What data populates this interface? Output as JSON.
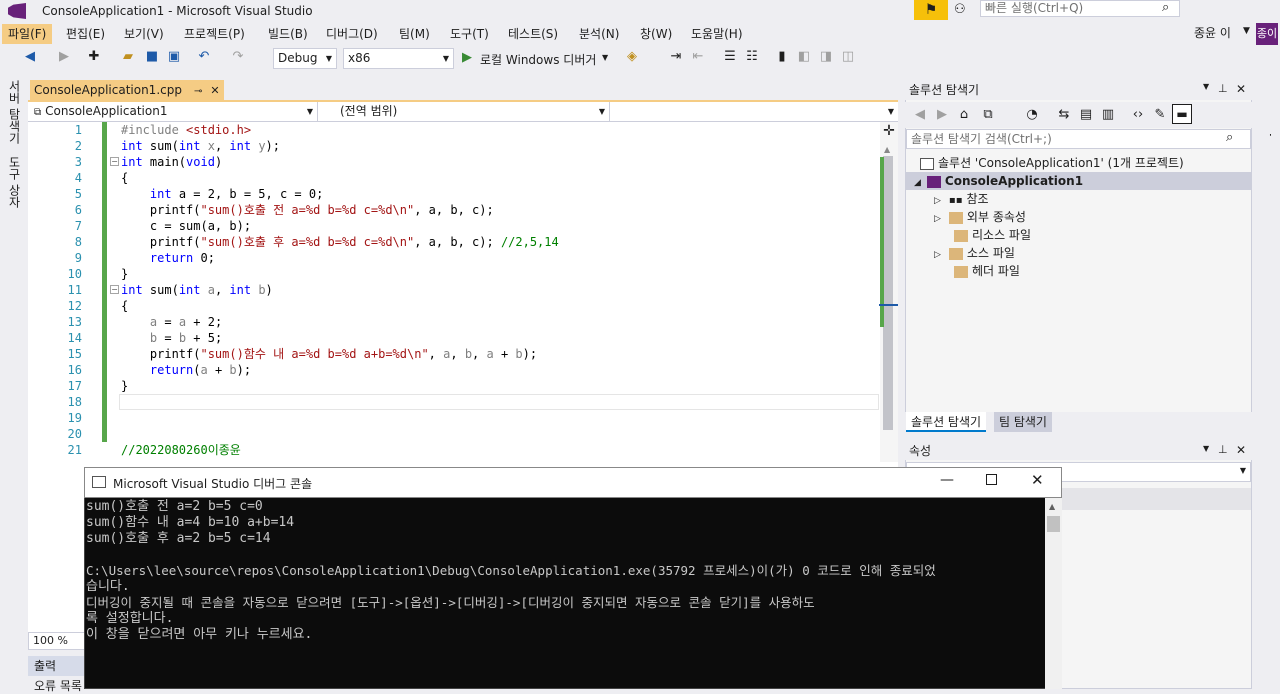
{
  "window": {
    "title": "ConsoleApplication1 - Microsoft Visual Studio",
    "quick_launch_placeholder": "빠른 실행(Ctrl+Q)",
    "user": "종윤 이",
    "user_badge": "종이"
  },
  "menu": [
    "파일(F)",
    "편집(E)",
    "보기(V)",
    "프로젝트(P)",
    "빌드(B)",
    "디버그(D)",
    "팀(M)",
    "도구(T)",
    "테스트(S)",
    "분석(N)",
    "창(W)",
    "도움말(H)"
  ],
  "toolbar": {
    "config": "Debug",
    "platform": "x86",
    "run_label": "로컬 Windows 디버거"
  },
  "left_strip": {
    "server_explorer": "서버 탐색기",
    "toolbox": "도구 상자"
  },
  "editor": {
    "tab_label": "ConsoleApplication1.cpp",
    "nav_project": "ConsoleApplication1",
    "nav_scope": "(전역 범위)",
    "zoom": "100 %",
    "line_numbers": [
      "1",
      "2",
      "3",
      "4",
      "5",
      "6",
      "7",
      "8",
      "9",
      "10",
      "11",
      "12",
      "13",
      "14",
      "15",
      "16",
      "17",
      "18",
      "19",
      "20",
      "21"
    ]
  },
  "code": {
    "l1a": "#include ",
    "l1b": "<stdio.h>",
    "l2a": "int",
    "l2b": " sum(",
    "l2c": "int",
    "l2d": " x",
    "l2e": ", ",
    "l2f": "int",
    "l2g": " y",
    "l2h": ");",
    "l3a": "int",
    "l3b": " main(",
    "l3c": "void",
    "l3d": ")",
    "l4": "{",
    "l5a": "    ",
    "l5b": "int",
    "l5c": " a = 2, b = 5, c = 0;",
    "l6a": "    printf(",
    "l6b": "\"sum()호출 전 a=%d b=%d c=%d\\n\"",
    "l6c": ", a, b, c);",
    "l7": "    c = sum(a, b);",
    "l8a": "    printf(",
    "l8b": "\"sum()호출 후 a=%d b=%d c=%d\\n\"",
    "l8c": ", a, b, c); ",
    "l8d": "//2,5,14",
    "l9a": "    ",
    "l9b": "return",
    "l9c": " 0;",
    "l10": "}",
    "l11a": "int",
    "l11b": " sum(",
    "l11c": "int",
    "l11d": " a",
    "l11e": ", ",
    "l11f": "int",
    "l11g": " b",
    "l11h": ")",
    "l12": "{",
    "l13a": "    ",
    "l13b": "a",
    "l13c": " = ",
    "l13d": "a",
    "l13e": " + 2;",
    "l14a": "    ",
    "l14b": "b",
    "l14c": " = ",
    "l14d": "b",
    "l14e": " + 5;",
    "l15a": "    printf(",
    "l15b": "\"sum()함수 내 a=%d b=%d a+b=%d\\n\"",
    "l15c": ", ",
    "l15d": "a",
    "l15e": ", ",
    "l15f": "b",
    "l15g": ", ",
    "l15h": "a",
    "l15i": " + ",
    "l15j": "b",
    "l15k": ");",
    "l16a": "    ",
    "l16b": "return",
    "l16c": "(",
    "l16d": "a",
    "l16e": " + ",
    "l16f": "b",
    "l16g": ");",
    "l17": "}",
    "l21": "//2022080260이종윤"
  },
  "solution_explorer": {
    "title": "솔루션 탐색기",
    "search_placeholder": "솔루션 탐색기 검색(Ctrl+;)",
    "solution": "솔루션 'ConsoleApplication1' (1개 프로젝트)",
    "project": "ConsoleApplication1",
    "items": [
      "참조",
      "외부 종속성",
      "리소스 파일",
      "소스 파일",
      "헤더 파일"
    ],
    "tab_active": "솔루션 탐색기",
    "tab_team": "팀 탐색기"
  },
  "properties": {
    "title": "속성"
  },
  "bottom": {
    "output": "출력",
    "errors": "오류 목록"
  },
  "console": {
    "title": "Microsoft Visual Studio 디버그 콘솔",
    "lines": [
      "sum()호출 전 a=2 b=5 c=0",
      "sum()함수 내 a=4 b=10 a+b=14",
      "sum()호출 후 a=2 b=5 c=14",
      "",
      "C:\\Users\\lee\\source\\repos\\ConsoleApplication1\\Debug\\ConsoleApplication1.exe(35792 프로세스)이(가) 0 코드로 인해 종료되었",
      "습니다.",
      "디버깅이 중지될 때 콘솔을 자동으로 닫으려면 [도구]->[옵션]->[디버깅]->[디버깅이 중지되면 자동으로 콘솔 닫기]를 사용하도",
      "록 설정합니다.",
      "이 창을 닫으려면 아무 키나 누르세요."
    ]
  }
}
